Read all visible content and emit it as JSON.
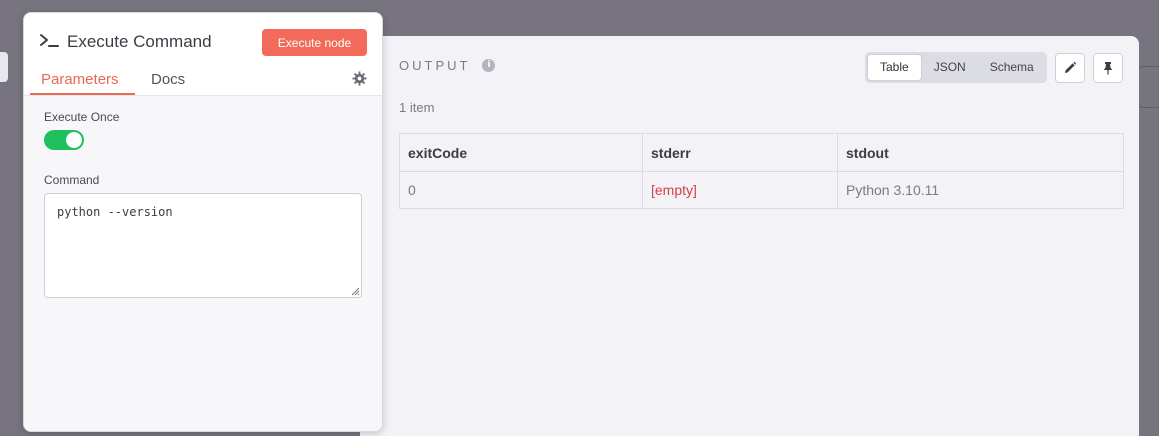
{
  "node": {
    "title": "Execute Command",
    "execute_button": "Execute node",
    "tabs": [
      {
        "label": "Parameters",
        "active": true
      },
      {
        "label": "Docs",
        "active": false
      }
    ]
  },
  "parameters": {
    "execute_once": {
      "label": "Execute Once",
      "value": true
    },
    "command": {
      "label": "Command",
      "value": "python --version"
    }
  },
  "output": {
    "title": "OUTPUT",
    "item_count": "1 item",
    "views": [
      "Table",
      "JSON",
      "Schema"
    ],
    "active_view": "Table",
    "columns": [
      "exitCode",
      "stderr",
      "stdout"
    ],
    "rows": [
      [
        "0",
        "[empty]",
        "Python 3.10.11"
      ]
    ]
  },
  "colors": {
    "accent": "#ea6b53",
    "execute_button": "#f26a5a",
    "toggle_on": "#20c05c",
    "empty_value": "#d0414b"
  }
}
